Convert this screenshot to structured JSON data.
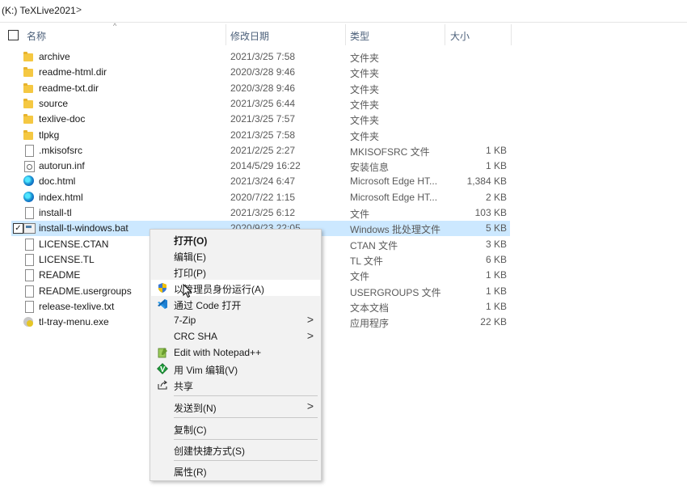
{
  "breadcrumb": {
    "path": "(K:) TeXLive2021",
    "chevron": ">"
  },
  "columns": {
    "name": "名称",
    "date": "修改日期",
    "type": "类型",
    "size": "大小"
  },
  "files": [
    {
      "name": "archive",
      "date": "2021/3/25 7:58",
      "type": "文件夹",
      "size": "",
      "icon": "folder-icon",
      "kind": "folder"
    },
    {
      "name": "readme-html.dir",
      "date": "2020/3/28 9:46",
      "type": "文件夹",
      "size": "",
      "icon": "folder-icon",
      "kind": "folder"
    },
    {
      "name": "readme-txt.dir",
      "date": "2020/3/28 9:46",
      "type": "文件夹",
      "size": "",
      "icon": "folder-icon",
      "kind": "folder"
    },
    {
      "name": "source",
      "date": "2021/3/25 6:44",
      "type": "文件夹",
      "size": "",
      "icon": "folder-icon",
      "kind": "folder"
    },
    {
      "name": "texlive-doc",
      "date": "2021/3/25 7:57",
      "type": "文件夹",
      "size": "",
      "icon": "folder-icon",
      "kind": "folder"
    },
    {
      "name": "tlpkg",
      "date": "2021/3/25 7:58",
      "type": "文件夹",
      "size": "",
      "icon": "folder-icon",
      "kind": "folder"
    },
    {
      "name": ".mkisofsrc",
      "date": "2021/2/25 2:27",
      "type": "MKISOFSRC 文件",
      "size": "1 KB",
      "icon": "file-icon",
      "kind": "file"
    },
    {
      "name": "autorun.inf",
      "date": "2014/5/29 16:22",
      "type": "安装信息",
      "size": "1 KB",
      "icon": "setup-info-icon",
      "kind": "setup"
    },
    {
      "name": "doc.html",
      "date": "2021/3/24 6:47",
      "type": "Microsoft Edge HT...",
      "size": "1,384 KB",
      "icon": "edge-icon",
      "kind": "edge"
    },
    {
      "name": "index.html",
      "date": "2020/7/22 1:15",
      "type": "Microsoft Edge HT...",
      "size": "2 KB",
      "icon": "edge-icon",
      "kind": "edge"
    },
    {
      "name": "install-tl",
      "date": "2021/3/25 6:12",
      "type": "文件",
      "size": "103 KB",
      "icon": "file-icon",
      "kind": "file"
    },
    {
      "name": "install-tl-windows.bat",
      "date": "2020/9/23 22:05",
      "type": "Windows 批处理文件",
      "size": "5 KB",
      "icon": "batch-file-icon",
      "kind": "bat",
      "selected": true
    },
    {
      "name": "LICENSE.CTAN",
      "date": "",
      "type": "CTAN 文件",
      "size": "3 KB",
      "icon": "file-icon",
      "kind": "file"
    },
    {
      "name": "LICENSE.TL",
      "date": "",
      "type": "TL 文件",
      "size": "6 KB",
      "icon": "file-icon",
      "kind": "file"
    },
    {
      "name": "README",
      "date": "",
      "type": "文件",
      "size": "1 KB",
      "icon": "file-icon",
      "kind": "file"
    },
    {
      "name": "README.usergroups",
      "date": "",
      "type": "USERGROUPS 文件",
      "size": "1 KB",
      "icon": "file-icon",
      "kind": "file"
    },
    {
      "name": "release-texlive.txt",
      "date": "",
      "type": "文本文档",
      "size": "1 KB",
      "icon": "text-file-icon",
      "kind": "file"
    },
    {
      "name": "tl-tray-menu.exe",
      "date": "",
      "type": "应用程序",
      "size": "22 KB",
      "icon": "app-icon",
      "kind": "exe"
    }
  ],
  "context_menu": {
    "open": "打开(O)",
    "edit": "编辑(E)",
    "print": "打印(P)",
    "run_as_admin": "以管理员身份运行(A)",
    "open_with_code": "通过 Code 打开",
    "seven_zip": "7-Zip",
    "crc_sha": "CRC SHA",
    "edit_notepadpp": "Edit with Notepad++",
    "edit_vim": "用 Vim 编辑(V)",
    "share": "共享",
    "send_to": "发送到(N)",
    "copy": "复制(C)",
    "create_shortcut": "创建快捷方式(S)",
    "properties": "属性(R)",
    "submenu_arrow": ">"
  },
  "colors": {
    "selection": "#cce8ff",
    "menu_bg": "#f2f2f2",
    "header_text": "#4c607a"
  }
}
